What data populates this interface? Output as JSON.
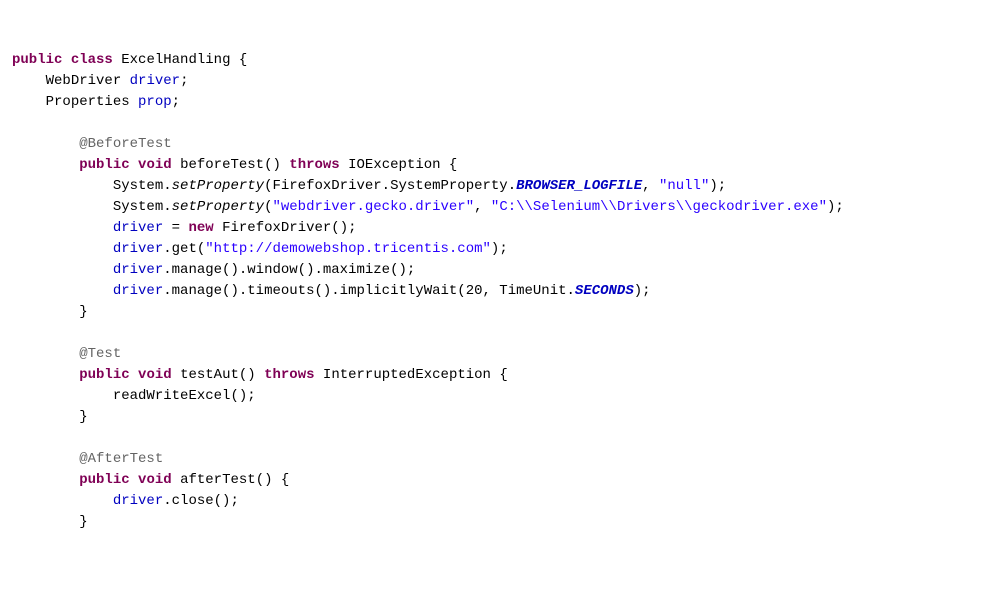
{
  "line1": {
    "kw_public": "public",
    "kw_class": "class",
    "name": "ExcelHandling",
    "brace": " {"
  },
  "line2": {
    "type": "WebDriver",
    "field": "driver",
    "semi": ";"
  },
  "line3": {
    "type": "Properties",
    "field": "prop",
    "semi": ";"
  },
  "line5": {
    "anno": "@BeforeTest"
  },
  "line6": {
    "kw_public": "public",
    "kw_void": "void",
    "method": "beforeTest",
    "rest": "() ",
    "kw_throws": "throws",
    "exc": " IOException {"
  },
  "line7": {
    "sys": "System.",
    "m": "setProperty",
    "open": "(FirefoxDriver.SystemProperty.",
    "sf": "BROWSER_LOGFILE",
    "comma": ", ",
    "str": "\"null\"",
    "close": ");",
    "indent": "            "
  },
  "line8": {
    "sys": "System.",
    "m": "setProperty",
    "open": "(",
    "str1": "\"webdriver.gecko.driver\"",
    "comma": ", ",
    "str2": "\"C:\\\\Selenium\\\\Drivers\\\\geckodriver.exe\"",
    "close": ");",
    "indent": "            "
  },
  "line9": {
    "field": "driver",
    "eq": " = ",
    "kw_new": "new",
    "rest": " FirefoxDriver();",
    "indent": "            "
  },
  "line10": {
    "field": "driver",
    "dot": ".get(",
    "str": "\"http://demowebshop.tricentis.com\"",
    "close": ");",
    "indent": "            "
  },
  "line11": {
    "field": "driver",
    "rest": ".manage().window().maximize();",
    "indent": "            "
  },
  "line12": {
    "field": "driver",
    "rest1": ".manage().timeouts().implicitlyWait(20, TimeUnit.",
    "sf": "SECONDS",
    "rest2": ");",
    "indent": "            "
  },
  "line13": {
    "brace": "}",
    "indent": "        "
  },
  "line15": {
    "anno": "@Test",
    "indent": "        "
  },
  "line16": {
    "kw_public": "public",
    "kw_void": "void",
    "method": "testAut",
    "rest": "() ",
    "kw_throws": "throws",
    "exc": " InterruptedException {",
    "indent": "        "
  },
  "line17": {
    "call": "readWriteExcel();",
    "indent": "            "
  },
  "line18": {
    "brace": "}",
    "indent": "        "
  },
  "line20": {
    "anno": "@AfterTest",
    "indent": "        "
  },
  "line21": {
    "kw_public": "public",
    "kw_void": "void",
    "method": "afterTest",
    "rest": "() {",
    "indent": "        "
  },
  "line22": {
    "field": "driver",
    "rest": ".close();",
    "indent": "            "
  },
  "line23": {
    "brace": "}",
    "indent": "        "
  }
}
